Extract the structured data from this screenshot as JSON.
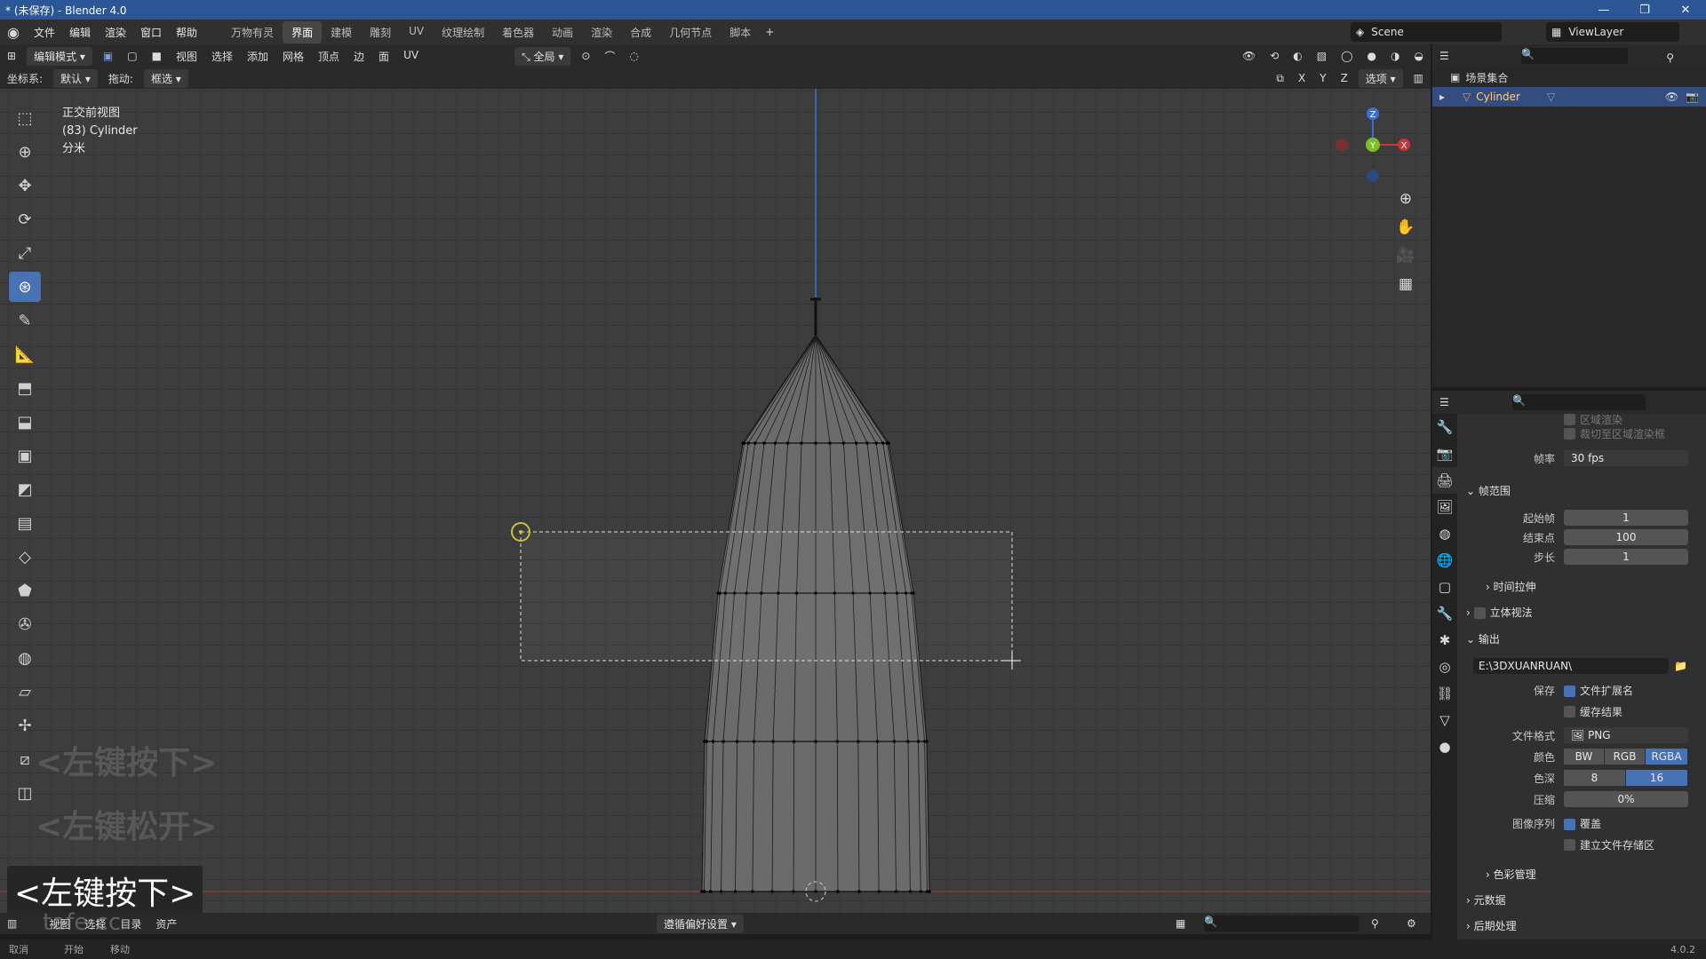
{
  "window": {
    "title": "* (未保存) - Blender 4.0",
    "minimize": "—",
    "maximize": "❐",
    "close": "✕"
  },
  "menu": [
    "文件",
    "编辑",
    "渲染",
    "窗口",
    "帮助"
  ],
  "workspaces": [
    "万物有灵",
    "界面",
    "建模",
    "雕刻",
    "UV",
    "纹理绘制",
    "着色器",
    "动画",
    "渲染",
    "合成",
    "几何节点",
    "脚本"
  ],
  "active_workspace_index": 1,
  "scene": {
    "label": "Scene",
    "viewlayer": "ViewLayer"
  },
  "viewport_header": {
    "mode": "编辑模式",
    "menus": [
      "视图",
      "选择",
      "添加",
      "网格",
      "顶点",
      "边",
      "面",
      "UV"
    ],
    "transform_orientation": "全局",
    "coord_label": "坐标系:",
    "coord_value": "默认",
    "drag_label": "拖动:",
    "drag_value": "框选",
    "axes": [
      "X",
      "Y",
      "Z"
    ],
    "options": "选项"
  },
  "viewport_info": {
    "line1": "正交前视图",
    "line2": "(83) Cylinder",
    "line3": "分米"
  },
  "overlays": {
    "hint1": "<左键按下>",
    "hint2": "<左键松开>",
    "keycap": "<左键按下>"
  },
  "bottom_bar": {
    "menus": [
      "视图",
      "选择",
      "目录",
      "资产"
    ],
    "dropdown": "遵循偏好设置",
    "watermark": "tafe.cc"
  },
  "status_bar": {
    "items": [
      "取消",
      "开始",
      "移动"
    ],
    "version": "4.0.2"
  },
  "outliner": {
    "collection": "场景集合",
    "object": "Cylinder"
  },
  "properties": {
    "faded1": "区域渲染",
    "faded2": "裁切至区域渲染框",
    "fps_label": "帧率",
    "fps_value": "30 fps",
    "frame_range": "帧范围",
    "start_label": "起始帧",
    "start_value": "1",
    "end_label": "结束点",
    "end_value": "100",
    "step_label": "步长",
    "step_value": "1",
    "time_stretch": "时间拉伸",
    "stereo": "立体视法",
    "output": "输出",
    "path": "E:\\3DXUANRUAN\\",
    "save_label": "保存",
    "file_ext": "文件扩展名",
    "cache": "缓存结果",
    "format_label": "文件格式",
    "format_value": "PNG",
    "color_label": "颜色",
    "color_options": [
      "BW",
      "RGB",
      "RGBA"
    ],
    "depth_label": "色深",
    "depth_options": [
      "8",
      "16"
    ],
    "compress_label": "压缩",
    "compress_value": "0%",
    "seq_label": "图像序列",
    "overwrite": "覆盖",
    "placeholders": "建立文件存储区",
    "color_mgmt": "色彩管理",
    "metadata": "元数据",
    "post": "后期处理"
  },
  "gizmo": {
    "z": "Z",
    "y": "Y",
    "x": "X"
  }
}
